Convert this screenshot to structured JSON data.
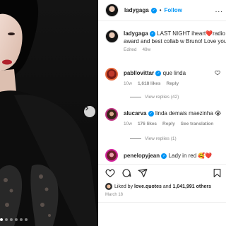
{
  "post": {
    "carousel": {
      "slides": 6,
      "active_index": 0
    }
  },
  "header": {
    "username": "ladygaga",
    "separator": "•",
    "follow_label": "Follow",
    "more_label": "..."
  },
  "caption": {
    "username": "ladygaga",
    "text_line1": "LAST NIGHT iheart❤️radio",
    "text_line2": "award and best collab w Bruno! Love you",
    "edited": "Edited",
    "time": "49w"
  },
  "comments": [
    {
      "username": "pabllovittar",
      "text": "que linda",
      "time": "10w",
      "likes": "1,618 likes",
      "reply_label": "Reply",
      "view_replies": "View replies (42)"
    },
    {
      "username": "alucarva",
      "text": "linda demais maezinha 😭",
      "time": "10w",
      "likes": "176 likes",
      "reply_label": "Reply",
      "translation_label": "See translation",
      "view_replies": "View replies (1)"
    },
    {
      "username": "penelopyjean",
      "text": "Lady in red 🥰❤️"
    }
  ],
  "likes_line": {
    "prefix": "Liked by",
    "user": "love.quotes",
    "middle": "and",
    "count": "1,041,991 others"
  },
  "date": "March 18",
  "colors": {
    "accent": "#0095f6",
    "heart": "#ed4956",
    "muted": "#8e8e8e"
  },
  "icons": [
    "verified-icon",
    "heart-icon",
    "comment-icon",
    "share-icon",
    "bookmark-icon",
    "chevron-right-icon"
  ]
}
